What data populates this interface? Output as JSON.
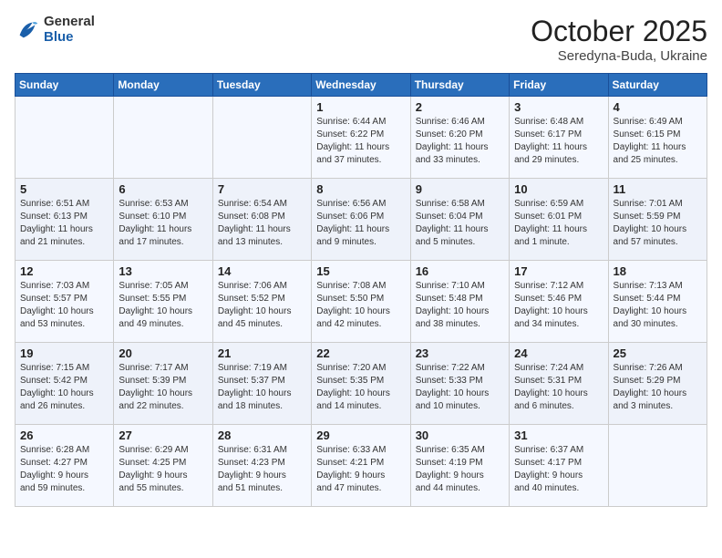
{
  "logo": {
    "general": "General",
    "blue": "Blue"
  },
  "header": {
    "month": "October 2025",
    "location": "Seredyna-Buda, Ukraine"
  },
  "weekdays": [
    "Sunday",
    "Monday",
    "Tuesday",
    "Wednesday",
    "Thursday",
    "Friday",
    "Saturday"
  ],
  "weeks": [
    [
      {
        "day": "",
        "info": ""
      },
      {
        "day": "",
        "info": ""
      },
      {
        "day": "",
        "info": ""
      },
      {
        "day": "1",
        "info": "Sunrise: 6:44 AM\nSunset: 6:22 PM\nDaylight: 11 hours\nand 37 minutes."
      },
      {
        "day": "2",
        "info": "Sunrise: 6:46 AM\nSunset: 6:20 PM\nDaylight: 11 hours\nand 33 minutes."
      },
      {
        "day": "3",
        "info": "Sunrise: 6:48 AM\nSunset: 6:17 PM\nDaylight: 11 hours\nand 29 minutes."
      },
      {
        "day": "4",
        "info": "Sunrise: 6:49 AM\nSunset: 6:15 PM\nDaylight: 11 hours\nand 25 minutes."
      }
    ],
    [
      {
        "day": "5",
        "info": "Sunrise: 6:51 AM\nSunset: 6:13 PM\nDaylight: 11 hours\nand 21 minutes."
      },
      {
        "day": "6",
        "info": "Sunrise: 6:53 AM\nSunset: 6:10 PM\nDaylight: 11 hours\nand 17 minutes."
      },
      {
        "day": "7",
        "info": "Sunrise: 6:54 AM\nSunset: 6:08 PM\nDaylight: 11 hours\nand 13 minutes."
      },
      {
        "day": "8",
        "info": "Sunrise: 6:56 AM\nSunset: 6:06 PM\nDaylight: 11 hours\nand 9 minutes."
      },
      {
        "day": "9",
        "info": "Sunrise: 6:58 AM\nSunset: 6:04 PM\nDaylight: 11 hours\nand 5 minutes."
      },
      {
        "day": "10",
        "info": "Sunrise: 6:59 AM\nSunset: 6:01 PM\nDaylight: 11 hours\nand 1 minute."
      },
      {
        "day": "11",
        "info": "Sunrise: 7:01 AM\nSunset: 5:59 PM\nDaylight: 10 hours\nand 57 minutes."
      }
    ],
    [
      {
        "day": "12",
        "info": "Sunrise: 7:03 AM\nSunset: 5:57 PM\nDaylight: 10 hours\nand 53 minutes."
      },
      {
        "day": "13",
        "info": "Sunrise: 7:05 AM\nSunset: 5:55 PM\nDaylight: 10 hours\nand 49 minutes."
      },
      {
        "day": "14",
        "info": "Sunrise: 7:06 AM\nSunset: 5:52 PM\nDaylight: 10 hours\nand 45 minutes."
      },
      {
        "day": "15",
        "info": "Sunrise: 7:08 AM\nSunset: 5:50 PM\nDaylight: 10 hours\nand 42 minutes."
      },
      {
        "day": "16",
        "info": "Sunrise: 7:10 AM\nSunset: 5:48 PM\nDaylight: 10 hours\nand 38 minutes."
      },
      {
        "day": "17",
        "info": "Sunrise: 7:12 AM\nSunset: 5:46 PM\nDaylight: 10 hours\nand 34 minutes."
      },
      {
        "day": "18",
        "info": "Sunrise: 7:13 AM\nSunset: 5:44 PM\nDaylight: 10 hours\nand 30 minutes."
      }
    ],
    [
      {
        "day": "19",
        "info": "Sunrise: 7:15 AM\nSunset: 5:42 PM\nDaylight: 10 hours\nand 26 minutes."
      },
      {
        "day": "20",
        "info": "Sunrise: 7:17 AM\nSunset: 5:39 PM\nDaylight: 10 hours\nand 22 minutes."
      },
      {
        "day": "21",
        "info": "Sunrise: 7:19 AM\nSunset: 5:37 PM\nDaylight: 10 hours\nand 18 minutes."
      },
      {
        "day": "22",
        "info": "Sunrise: 7:20 AM\nSunset: 5:35 PM\nDaylight: 10 hours\nand 14 minutes."
      },
      {
        "day": "23",
        "info": "Sunrise: 7:22 AM\nSunset: 5:33 PM\nDaylight: 10 hours\nand 10 minutes."
      },
      {
        "day": "24",
        "info": "Sunrise: 7:24 AM\nSunset: 5:31 PM\nDaylight: 10 hours\nand 6 minutes."
      },
      {
        "day": "25",
        "info": "Sunrise: 7:26 AM\nSunset: 5:29 PM\nDaylight: 10 hours\nand 3 minutes."
      }
    ],
    [
      {
        "day": "26",
        "info": "Sunrise: 6:28 AM\nSunset: 4:27 PM\nDaylight: 9 hours\nand 59 minutes."
      },
      {
        "day": "27",
        "info": "Sunrise: 6:29 AM\nSunset: 4:25 PM\nDaylight: 9 hours\nand 55 minutes."
      },
      {
        "day": "28",
        "info": "Sunrise: 6:31 AM\nSunset: 4:23 PM\nDaylight: 9 hours\nand 51 minutes."
      },
      {
        "day": "29",
        "info": "Sunrise: 6:33 AM\nSunset: 4:21 PM\nDaylight: 9 hours\nand 47 minutes."
      },
      {
        "day": "30",
        "info": "Sunrise: 6:35 AM\nSunset: 4:19 PM\nDaylight: 9 hours\nand 44 minutes."
      },
      {
        "day": "31",
        "info": "Sunrise: 6:37 AM\nSunset: 4:17 PM\nDaylight: 9 hours\nand 40 minutes."
      },
      {
        "day": "",
        "info": ""
      }
    ]
  ]
}
